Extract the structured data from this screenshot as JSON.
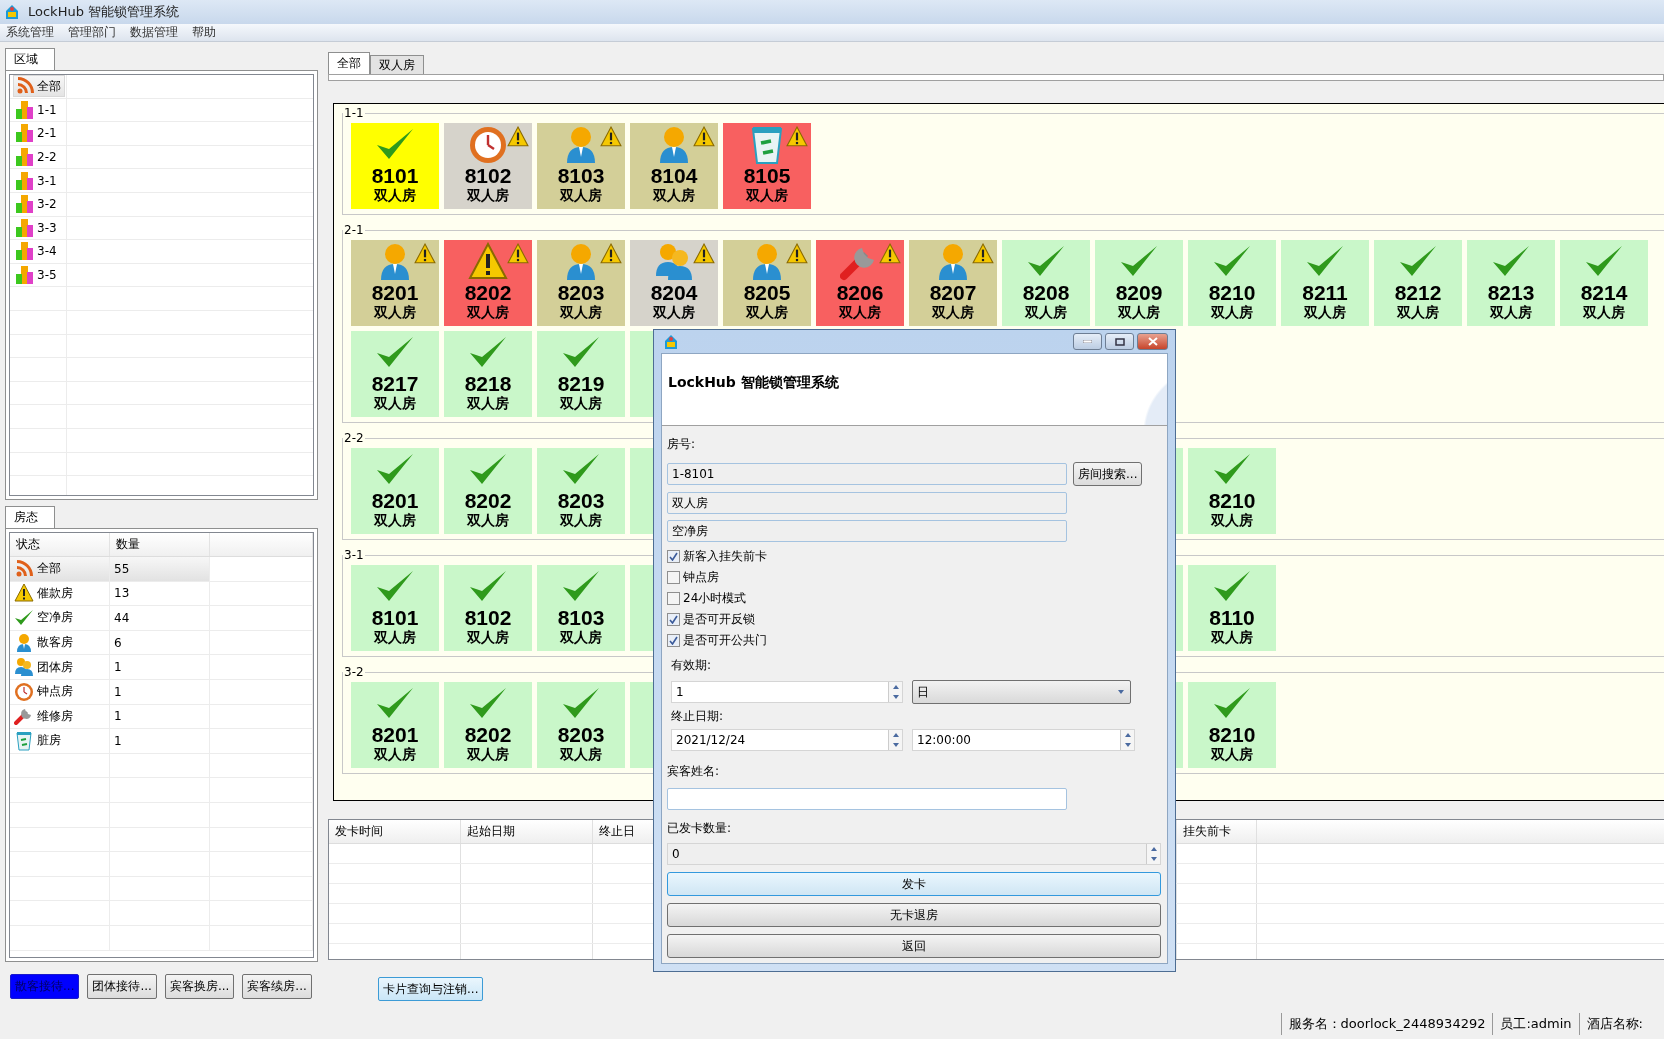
{
  "window": {
    "title": "LockHub 智能锁管理系统"
  },
  "menu": [
    "系统管理",
    "管理部门",
    "数据管理",
    "帮助"
  ],
  "area_panel": {
    "tab": "区域",
    "items": [
      {
        "label": "全部",
        "kind": "all",
        "selected": true
      },
      {
        "label": "1-1",
        "kind": "building",
        "selected": false
      },
      {
        "label": "2-1",
        "kind": "building",
        "selected": false
      },
      {
        "label": "2-2",
        "kind": "building",
        "selected": false
      },
      {
        "label": "3-1",
        "kind": "building",
        "selected": false
      },
      {
        "label": "3-2",
        "kind": "building",
        "selected": false
      },
      {
        "label": "3-3",
        "kind": "building",
        "selected": false
      },
      {
        "label": "3-4",
        "kind": "building",
        "selected": false
      },
      {
        "label": "3-5",
        "kind": "building",
        "selected": false
      }
    ]
  },
  "status_panel": {
    "tab": "房态",
    "columns": [
      "状态",
      "数量"
    ],
    "rows": [
      {
        "kind": "all",
        "label": "全部",
        "count": "55",
        "selected": true
      },
      {
        "kind": "alert",
        "label": "催款房",
        "count": "13",
        "selected": false
      },
      {
        "kind": "clean",
        "label": "空净房",
        "count": "44",
        "selected": false
      },
      {
        "kind": "guest",
        "label": "散客房",
        "count": "6",
        "selected": false
      },
      {
        "kind": "group",
        "label": "团体房",
        "count": "1",
        "selected": false
      },
      {
        "kind": "clock",
        "label": "钟点房",
        "count": "1",
        "selected": false
      },
      {
        "kind": "repair",
        "label": "维修房",
        "count": "1",
        "selected": false
      },
      {
        "kind": "dirty",
        "label": "脏房",
        "count": "1",
        "selected": false
      }
    ]
  },
  "actions": [
    {
      "label": "散客接待...",
      "selected": true
    },
    {
      "label": "团体接待...",
      "selected": false
    },
    {
      "label": "宾客换房...",
      "selected": false
    },
    {
      "label": "宾客续房...",
      "selected": false
    }
  ],
  "room_tabs": [
    {
      "label": "全部",
      "selected": true
    },
    {
      "label": "双人房",
      "selected": false
    }
  ],
  "groups": [
    {
      "name": "1-1",
      "rows": [
        [
          {
            "number": "8101",
            "type": "双人房",
            "kind": "clean",
            "color": "#ffff00",
            "alert": false
          },
          {
            "number": "8102",
            "type": "双人房",
            "kind": "clock",
            "color": "#d6d3cb",
            "alert": true
          },
          {
            "number": "8103",
            "type": "双人房",
            "kind": "guest",
            "color": "#d3cf98",
            "alert": true
          },
          {
            "number": "8104",
            "type": "双人房",
            "kind": "guest",
            "color": "#d3cf98",
            "alert": true
          },
          {
            "number": "8105",
            "type": "双人房",
            "kind": "dirty",
            "color": "#f86060",
            "alert": true
          }
        ]
      ]
    },
    {
      "name": "2-1",
      "rows": [
        [
          {
            "number": "8201",
            "type": "双人房",
            "kind": "guest",
            "color": "#d3cf98",
            "alert": true
          },
          {
            "number": "8202",
            "type": "双人房",
            "kind": "warning",
            "color": "#f86060",
            "alert": true
          },
          {
            "number": "8203",
            "type": "双人房",
            "kind": "guest",
            "color": "#d3cf98",
            "alert": true
          },
          {
            "number": "8204",
            "type": "双人房",
            "kind": "group",
            "color": "#d6d3cb",
            "alert": true
          },
          {
            "number": "8205",
            "type": "双人房",
            "kind": "guest",
            "color": "#d3cf98",
            "alert": true
          },
          {
            "number": "8206",
            "type": "双人房",
            "kind": "repair",
            "color": "#f86060",
            "alert": true
          },
          {
            "number": "8207",
            "type": "双人房",
            "kind": "guest",
            "color": "#d3cf98",
            "alert": true
          },
          {
            "number": "8208",
            "type": "双人房",
            "kind": "clean",
            "color": "#c9f7c9",
            "alert": false
          },
          {
            "number": "8209",
            "type": "双人房",
            "kind": "clean",
            "color": "#c9f7c9",
            "alert": false
          },
          {
            "number": "8210",
            "type": "双人房",
            "kind": "clean",
            "color": "#c9f7c9",
            "alert": false
          },
          {
            "number": "8211",
            "type": "双人房",
            "kind": "clean",
            "color": "#c9f7c9",
            "alert": false
          },
          {
            "number": "8212",
            "type": "双人房",
            "kind": "clean",
            "color": "#c9f7c9",
            "alert": false
          },
          {
            "number": "8213",
            "type": "双人房",
            "kind": "clean",
            "color": "#c9f7c9",
            "alert": false
          },
          {
            "number": "8214",
            "type": "双人房",
            "kind": "clean",
            "color": "#c9f7c9",
            "alert": false
          }
        ],
        [
          {
            "number": "8217",
            "type": "双人房",
            "kind": "clean",
            "color": "#c9f7c9",
            "alert": false
          },
          {
            "number": "8218",
            "type": "双人房",
            "kind": "clean",
            "color": "#c9f7c9",
            "alert": false
          },
          {
            "number": "8219",
            "type": "双人房",
            "kind": "clean",
            "color": "#c9f7c9",
            "alert": false
          },
          {
            "kind": "covered",
            "color": "#c9f7c9",
            "alert": false
          }
        ]
      ]
    },
    {
      "name": "2-2",
      "rows": [
        [
          {
            "number": "8201",
            "type": "双人房",
            "kind": "clean",
            "color": "#c9f7c9",
            "alert": false
          },
          {
            "number": "8202",
            "type": "双人房",
            "kind": "clean",
            "color": "#c9f7c9",
            "alert": false
          },
          {
            "number": "8203",
            "type": "双人房",
            "kind": "clean",
            "color": "#c9f7c9",
            "alert": false
          },
          {
            "kind": "covered",
            "color": "#c9f7c9",
            "alert": false
          },
          {
            "kind": "covered",
            "color": "#c9f7c9",
            "alert": false
          },
          {
            "number": "8210",
            "type": "双人房",
            "kind": "clean",
            "color": "#c9f7c9",
            "alert": false
          }
        ]
      ]
    },
    {
      "name": "3-1",
      "rows": [
        [
          {
            "number": "8101",
            "type": "双人房",
            "kind": "clean",
            "color": "#c9f7c9",
            "alert": false
          },
          {
            "number": "8102",
            "type": "双人房",
            "kind": "clean",
            "color": "#c9f7c9",
            "alert": false
          },
          {
            "number": "8103",
            "type": "双人房",
            "kind": "clean",
            "color": "#c9f7c9",
            "alert": false
          },
          {
            "kind": "covered",
            "color": "#c9f7c9",
            "alert": false
          },
          {
            "kind": "covered",
            "color": "#c9f7c9",
            "alert": false
          },
          {
            "number": "8110",
            "type": "双人房",
            "kind": "clean",
            "color": "#c9f7c9",
            "alert": false
          }
        ]
      ]
    },
    {
      "name": "3-2",
      "rows": [
        [
          {
            "number": "8201",
            "type": "双人房",
            "kind": "clean",
            "color": "#c9f7c9",
            "alert": false
          },
          {
            "number": "8202",
            "type": "双人房",
            "kind": "clean",
            "color": "#c9f7c9",
            "alert": false
          },
          {
            "number": "8203",
            "type": "双人房",
            "kind": "clean",
            "color": "#c9f7c9",
            "alert": false
          },
          {
            "kind": "covered",
            "color": "#c9f7c9",
            "alert": false
          },
          {
            "kind": "covered",
            "color": "#c9f7c9",
            "alert": false
          },
          {
            "number": "8210",
            "type": "双人房",
            "kind": "clean",
            "color": "#c9f7c9",
            "alert": false
          }
        ]
      ]
    }
  ],
  "card_table": {
    "columns": [
      "发卡时间",
      "起始日期",
      "终止日",
      "挂失前卡"
    ]
  },
  "card_query_button": "卡片查询与注销...",
  "dialog": {
    "title": "LockHub 智能锁管理系统",
    "room_label": "房号:",
    "room_number": "1-8101",
    "search_button": "房间搜索...",
    "room_type": "双人房",
    "room_status": "空净房",
    "checkboxes": [
      {
        "label": "新客入挂失前卡",
        "checked": true
      },
      {
        "label": "钟点房",
        "checked": false
      },
      {
        "label": "24小时模式",
        "checked": false
      },
      {
        "label": "是否可开反锁",
        "checked": true
      },
      {
        "label": "是否可开公共门",
        "checked": true
      }
    ],
    "validity_label": "有效期:",
    "validity_value": "1",
    "validity_unit": "日",
    "end_label": "终止日期:",
    "end_date": "2021/12/24",
    "end_time": "12:00:00",
    "guest_label": "宾客姓名:",
    "issued_label": "已发卡数量:",
    "issued_value": "0",
    "buttons": [
      "发卡",
      "无卡退房",
      "返回"
    ]
  },
  "status_bar": [
    "服务名：doorlock_2448934292",
    "员工:admin",
    "酒店名称:"
  ]
}
